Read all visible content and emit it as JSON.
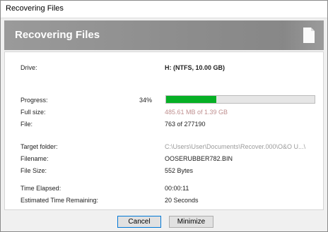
{
  "window": {
    "title": "Recovering Files"
  },
  "header": {
    "title": "Recovering Files",
    "icon": "document-icon"
  },
  "details": {
    "drive_label": "Drive:",
    "drive_value": "H: (NTFS, 10.00 GB)",
    "progress_label": "Progress:",
    "progress_percent_text": "34%",
    "progress_fraction": 0.34,
    "full_size_label": "Full size:",
    "full_size_value": "485.61 MB of 1.39 GB",
    "file_label": "File:",
    "file_value": "763 of 277190",
    "target_folder_label": "Target folder:",
    "target_folder_value": "C:\\Users\\User\\Documents\\Recover.000\\O&O U...\\",
    "filename_label": "Filename:",
    "filename_value": "OOSERUBBER782.BIN",
    "file_size_label": "File Size:",
    "file_size_value": "552 Bytes",
    "time_elapsed_label": "Time Elapsed:",
    "time_elapsed_value": "00:00:11",
    "time_remaining_label": "Estimated Time Remaining:",
    "time_remaining_value": "20 Seconds"
  },
  "buttons": {
    "cancel_label": "Cancel",
    "minimize_label": "Minimize"
  },
  "colors": {
    "progress_fill": "#06b025",
    "header_bg": "#8c8c8c",
    "default_button_border": "#0078d7"
  }
}
